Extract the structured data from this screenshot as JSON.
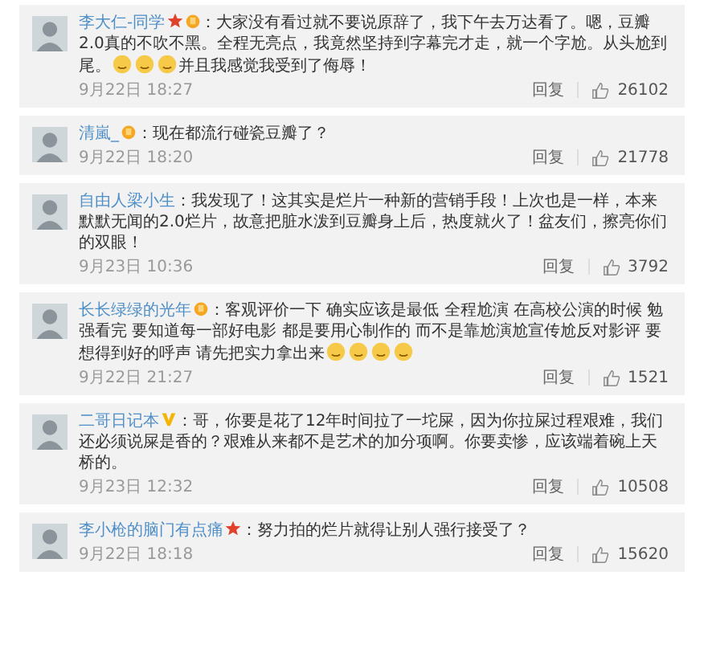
{
  "comments": [
    {
      "user": "李大仁-同学",
      "badges": [
        {
          "kind": "star"
        },
        {
          "kind": "medal"
        }
      ],
      "segments": [
        {
          "kind": "text",
          "text": "：大家没有看过就不要说原辞了，我下午去万达看了。嗯，豆瓣2.0真的不吹不黑。全程无亮点，我竟然坚持到字幕完才走，就一个字尬。从头尬到尾。"
        },
        {
          "kind": "emoji"
        },
        {
          "kind": "emoji"
        },
        {
          "kind": "emoji"
        },
        {
          "kind": "text",
          "text": "并且我感觉我受到了侮辱！"
        }
      ],
      "time": "9月22日 18:27",
      "reply": "回复",
      "likes": "26102"
    },
    {
      "user": "清嵐_",
      "badges": [
        {
          "kind": "medal"
        }
      ],
      "segments": [
        {
          "kind": "text",
          "text": "：现在都流行碰瓷豆瓣了？"
        }
      ],
      "time": "9月22日 18:20",
      "reply": "回复",
      "likes": "21778"
    },
    {
      "user": "自由人梁小生",
      "segments": [
        {
          "kind": "text",
          "text": "：我发现了！这其实是烂片一种新的营销手段！上次也是一样，本来默默无闻的2.0烂片，故意把脏水泼到豆瓣身上后，热度就火了！盆友们，擦亮你们的双眼！"
        }
      ],
      "time": "9月23日 10:36",
      "reply": "回复",
      "likes": "3792"
    },
    {
      "user": "长长绿绿的光年",
      "badges": [
        {
          "kind": "medal"
        }
      ],
      "segments": [
        {
          "kind": "text",
          "text": "：客观评价一下 确实应该是最低 全程尬演 在高校公演的时候 勉强看完 要知道每一部好电影 都是要用心制作的 而不是靠尬演尬宣传尬反对影评 要想得到好的呼声 请先把实力拿出来"
        },
        {
          "kind": "emoji"
        },
        {
          "kind": "emoji"
        },
        {
          "kind": "emoji"
        },
        {
          "kind": "emoji"
        }
      ],
      "time": "9月22日 21:27",
      "reply": "回复",
      "likes": "1521"
    },
    {
      "user": "二哥日记本",
      "badges": [
        {
          "kind": "v"
        }
      ],
      "segments": [
        {
          "kind": "text",
          "text": "：哥，你要是花了12年时间拉了一坨屎，因为你拉屎过程艰难，我们还必须说屎是香的？艰难从来都不是艺术的加分项啊。你要卖惨，应该端着碗上天桥的。"
        }
      ],
      "time": "9月23日 12:32",
      "reply": "回复",
      "likes": "10508"
    },
    {
      "user": "李小枪的脑门有点痛",
      "badges": [
        {
          "kind": "star"
        }
      ],
      "segments": [
        {
          "kind": "text",
          "text": "：努力拍的烂片就得让别人强行接受了？"
        }
      ],
      "time": "9月22日 18:18",
      "reply": "回复",
      "likes": "15620"
    }
  ]
}
